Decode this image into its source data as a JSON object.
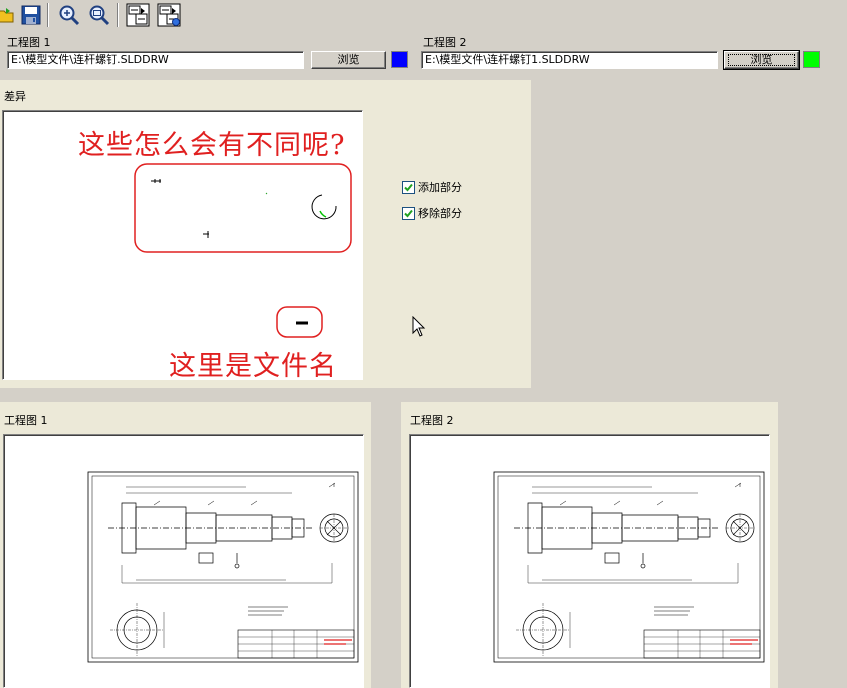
{
  "toolbar": {
    "buttons": [
      {
        "name": "open-icon"
      },
      {
        "name": "save-icon"
      },
      {
        "name": "zoom-in-icon"
      },
      {
        "name": "zoom-fit-icon"
      },
      {
        "name": "compare-sheets-icon"
      },
      {
        "name": "compare-files-icon"
      }
    ]
  },
  "drawing1": {
    "label": "工程图 1",
    "path": "E:\\模型文件\\连杆螺钉.SLDDRW",
    "browse": "浏览",
    "color": "#0000ff"
  },
  "drawing2": {
    "label": "工程图 2",
    "path": "E:\\模型文件\\连杆螺钉1.SLDDRW",
    "browse": "浏览",
    "color": "#00ff00"
  },
  "diff": {
    "title": "差异",
    "added_label": "添加部分",
    "added_checked": true,
    "removed_label": "移除部分",
    "removed_checked": true,
    "annotation_top": "这些怎么会有不同呢?",
    "annotation_bottom": "这里是文件名"
  },
  "preview1": {
    "title": "工程图 1"
  },
  "preview2": {
    "title": "工程图 2"
  },
  "colors": {
    "face": "#d4d0c8",
    "panel": "#ece9d8",
    "annotation": "#e02020"
  }
}
